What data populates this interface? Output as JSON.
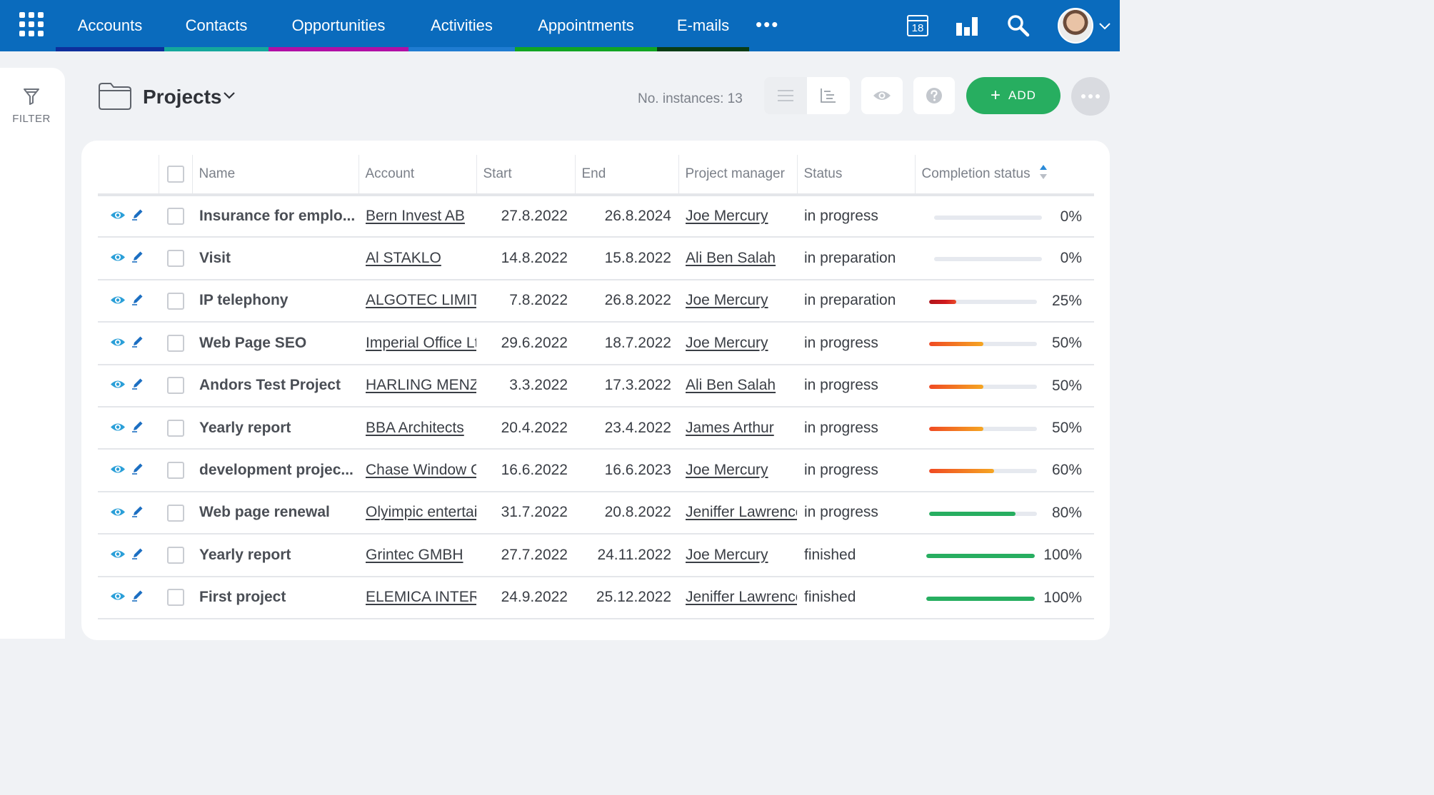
{
  "colors": {
    "topbar": "#0a6bbd",
    "add_button": "#27ae60",
    "nav_underlines": [
      "#0d2f9c",
      "#14a89c",
      "#b10fa5",
      "#1f7cd1",
      "#11a523",
      "#093d16"
    ],
    "progress_red": "#d0191e",
    "progress_orange": "#f5a623",
    "progress_green": "#27ae60"
  },
  "topbar": {
    "apps_icon": "grid-apps-icon",
    "nav": [
      "Accounts",
      "Contacts",
      "Opportunities",
      "Activities",
      "Appointments",
      "E-mails"
    ],
    "more_label": "•••",
    "calendar_day": "18",
    "icons": [
      "calendar-icon",
      "bar-chart-icon",
      "search-icon",
      "avatar",
      "chevron-down-icon"
    ]
  },
  "sidebar": {
    "filter_label": "FILTER",
    "filter_icon": "funnel-icon"
  },
  "header": {
    "title": "Projects",
    "instances": "No. instances: 13",
    "add_label": "ADD"
  },
  "table": {
    "columns": [
      "Name",
      "Account",
      "Start",
      "End",
      "Project manager",
      "Status",
      "Completion status"
    ],
    "rows": [
      {
        "name": "Insurance for emplo...",
        "account": "Bern Invest AB",
        "start": "27.8.2022",
        "end": "26.8.2024",
        "pm": "Joe Mercury",
        "status": "in progress",
        "completion": 0,
        "completion_label": "0%"
      },
      {
        "name": "Visit",
        "account": "Al STAKLO",
        "start": "14.8.2022",
        "end": "15.8.2022",
        "pm": "Ali Ben Salah",
        "status": "in preparation",
        "completion": 0,
        "completion_label": "0%"
      },
      {
        "name": "IP telephony",
        "account": "ALGOTEC LIMITED",
        "start": "7.8.2022",
        "end": "26.8.2022",
        "pm": "Joe Mercury",
        "status": "in preparation",
        "completion": 25,
        "completion_label": "25%"
      },
      {
        "name": "Web Page SEO",
        "account": "Imperial Office Ltd.",
        "start": "29.6.2022",
        "end": "18.7.2022",
        "pm": "Joe Mercury",
        "status": "in progress",
        "completion": 50,
        "completion_label": "50%"
      },
      {
        "name": "Andors Test Project",
        "account": "HARLING MENZIES",
        "start": "3.3.2022",
        "end": "17.3.2022",
        "pm": "Ali Ben Salah",
        "status": "in progress",
        "completion": 50,
        "completion_label": "50%"
      },
      {
        "name": "Yearly report",
        "account": "BBA Architects",
        "start": "20.4.2022",
        "end": "23.4.2022",
        "pm": "James Arthur",
        "status": "in progress",
        "completion": 50,
        "completion_label": "50%"
      },
      {
        "name": "development projec...",
        "account": "Chase Window Co.",
        "start": "16.6.2022",
        "end": "16.6.2023",
        "pm": "Joe Mercury",
        "status": "in progress",
        "completion": 60,
        "completion_label": "60%"
      },
      {
        "name": "Web page renewal",
        "account": "Olyimpic entertainment",
        "start": "31.7.2022",
        "end": "20.8.2022",
        "pm": "Jeniffer Lawrence",
        "status": "in progress",
        "completion": 80,
        "completion_label": "80%"
      },
      {
        "name": "Yearly report",
        "account": "Grintec GMBH",
        "start": "27.7.2022",
        "end": "24.11.2022",
        "pm": "Joe Mercury",
        "status": "finished",
        "completion": 100,
        "completion_label": "100%"
      },
      {
        "name": "First project",
        "account": "ELEMICA INTERNATIONAL",
        "start": "24.9.2022",
        "end": "25.12.2022",
        "pm": "Jeniffer Lawrence",
        "status": "finished",
        "completion": 100,
        "completion_label": "100%"
      }
    ]
  }
}
